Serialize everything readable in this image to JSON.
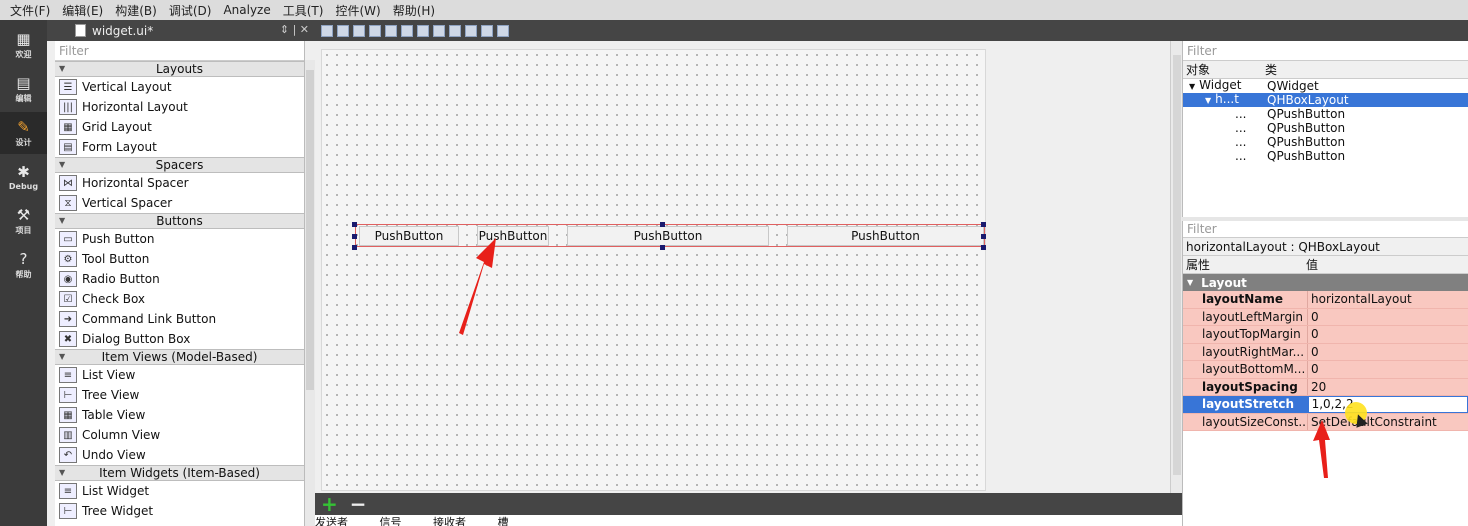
{
  "menubar": {
    "items": [
      "文件(F)",
      "编辑(E)",
      "构建(B)",
      "调试(D)",
      "Analyze",
      "工具(T)",
      "控件(W)",
      "帮助(H)"
    ]
  },
  "modes": [
    {
      "label": "欢迎",
      "icon": "grid-icon"
    },
    {
      "label": "编辑",
      "icon": "document-icon"
    },
    {
      "label": "设计",
      "icon": "pencil-icon"
    },
    {
      "label": "Debug",
      "icon": "bug-icon"
    },
    {
      "label": "项目",
      "icon": "wrench-icon"
    },
    {
      "label": "帮助",
      "icon": "help-icon"
    }
  ],
  "document": {
    "filename": "widget.ui*"
  },
  "widget_box": {
    "filter_placeholder": "Filter",
    "categories": [
      {
        "name": "Layouts",
        "items": [
          "Vertical Layout",
          "Horizontal Layout",
          "Grid Layout",
          "Form Layout"
        ]
      },
      {
        "name": "Spacers",
        "items": [
          "Horizontal Spacer",
          "Vertical Spacer"
        ]
      },
      {
        "name": "Buttons",
        "items": [
          "Push Button",
          "Tool Button",
          "Radio Button",
          "Check Box",
          "Command Link Button",
          "Dialog Button Box"
        ]
      },
      {
        "name": "Item Views (Model-Based)",
        "items": [
          "List View",
          "Tree View",
          "Table View",
          "Column View",
          "Undo View"
        ]
      },
      {
        "name": "Item Widgets (Item-Based)",
        "items": [
          "List Widget",
          "Tree Widget"
        ]
      }
    ]
  },
  "form": {
    "buttons": [
      "PushButton",
      "PushButton",
      "PushButton",
      "PushButton"
    ],
    "stretch": [
      1,
      0,
      2,
      2
    ]
  },
  "signals": {
    "columns": [
      "发送者",
      "信号",
      "接收者",
      "槽"
    ]
  },
  "object_inspector": {
    "filter_placeholder": "Filter",
    "col_object": "对象",
    "col_class": "类",
    "rows": [
      {
        "object": "Widget",
        "class": "QWidget",
        "selected": false
      },
      {
        "object": "h...t",
        "class": "QHBoxLayout",
        "selected": true
      },
      {
        "object": "...",
        "class": "QPushButton",
        "selected": false
      },
      {
        "object": "...",
        "class": "QPushButton",
        "selected": false
      },
      {
        "object": "...",
        "class": "QPushButton",
        "selected": false
      },
      {
        "object": "...",
        "class": "QPushButton",
        "selected": false
      }
    ]
  },
  "property_editor": {
    "filter_placeholder": "Filter",
    "class_line": "horizontalLayout : QHBoxLayout",
    "col_property": "属性",
    "col_value": "值",
    "group": "Layout",
    "properties": [
      {
        "name": "layoutName",
        "value": "horizontalLayout",
        "bold": true
      },
      {
        "name": "layoutLeftMargin",
        "value": "0",
        "bold": false
      },
      {
        "name": "layoutTopMargin",
        "value": "0",
        "bold": false
      },
      {
        "name": "layoutRightMar...",
        "value": "0",
        "bold": false
      },
      {
        "name": "layoutBottomM...",
        "value": "0",
        "bold": false
      },
      {
        "name": "layoutSpacing",
        "value": "20",
        "bold": true
      },
      {
        "name": "layoutStretch",
        "value": "1,0,2,2",
        "bold": true,
        "selected": true
      },
      {
        "name": "layoutSizeConst...",
        "value": "SetDefaultConstraint",
        "bold": false
      }
    ]
  },
  "colors": {
    "selection": "#3875d7",
    "property_bg": "#f9c8c0",
    "annotation_arrow": "#e8201a"
  }
}
